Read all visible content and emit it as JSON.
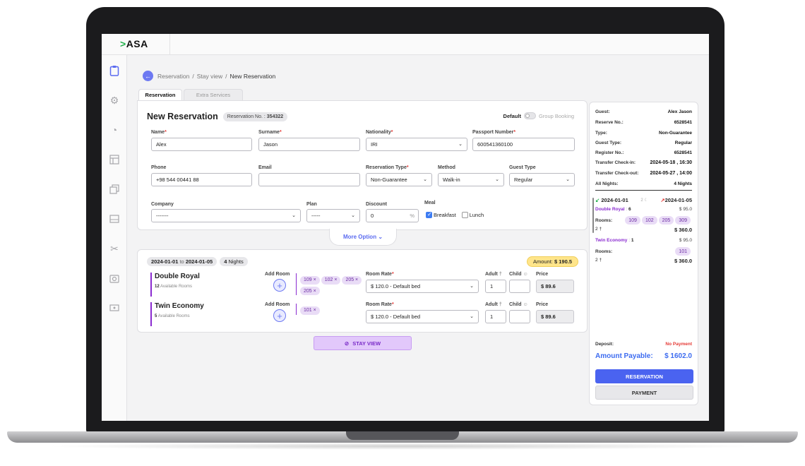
{
  "app": {
    "logo_prefix": ">",
    "logo_text": "ASA"
  },
  "sidebar": {
    "icons": [
      "clipboard-icon",
      "gear-icon",
      "pie-chart-icon",
      "layout-icon",
      "copy-icon",
      "wallet-icon",
      "magic-icon",
      "camera-icon",
      "money-icon"
    ]
  },
  "breadcrumb": {
    "items": [
      "Reservation",
      "Stay view",
      "New Reservation"
    ],
    "separator": "/"
  },
  "tabs": [
    "Reservation",
    "Extra Services"
  ],
  "form": {
    "title": "New Reservation",
    "reservation_no_label": "Reservation No. :",
    "reservation_no": "354322",
    "default_label": "Default",
    "group_label": "Group Booking",
    "fields": {
      "name": {
        "label": "Name",
        "value": "Alex"
      },
      "surname": {
        "label": "Surname",
        "value": "Jason"
      },
      "nationality": {
        "label": "Nationality",
        "value": "IRI"
      },
      "passport": {
        "label": "Passport Number",
        "value": "600541360100"
      },
      "phone": {
        "label": "Phone",
        "value": "+98 544 00441 88"
      },
      "email": {
        "label": "Email",
        "value": ""
      },
      "reservation_type": {
        "label": "Reservation Type",
        "value": "Non-Guarantee"
      },
      "method": {
        "label": "Method",
        "value": "Walk-in"
      },
      "guest_type": {
        "label": "Guest Type",
        "value": "Regular"
      },
      "company": {
        "label": "Company",
        "value": "-------"
      },
      "plan": {
        "label": "Plan",
        "value": "-----"
      },
      "discount": {
        "label": "Discount",
        "value": "0",
        "unit": "%"
      },
      "meal": {
        "label": "Meal",
        "breakfast": "Breakfast",
        "lunch": "Lunch"
      }
    },
    "more_option": "More Option"
  },
  "stay": {
    "from": "2024-01-01",
    "to_word": "to",
    "to": "2024-01-05",
    "nights_count": "4",
    "nights_word": "Nights",
    "amount_label": "Amount:",
    "amount": "$ 190.5",
    "rooms": [
      {
        "name": "Double Royal",
        "available_count": "12",
        "available_text": "Available Rooms",
        "add_room": "Add Room",
        "pills": [
          "109 ×",
          "102 ×",
          "205 ×",
          "205 ×"
        ],
        "rate_label": "Room Rate",
        "rate": "$ 120.0 - Default bed",
        "adult_label": "Adult",
        "adult": "1",
        "child_label": "Child",
        "child": "",
        "price_label": "Price",
        "price": "$ 89.6"
      },
      {
        "name": "Twin Economy",
        "available_count": "5",
        "available_text": "Available Rooms",
        "add_room": "Add Room",
        "pills": [
          "101 ×"
        ],
        "rate_label": "Room Rate",
        "rate": "$ 120.0 - Default bed",
        "adult_label": "Adult",
        "adult": "1",
        "child_label": "Child",
        "child": "",
        "price_label": "Price",
        "price": "$ 89.6"
      }
    ],
    "stay_view_button": "STAY VIEW"
  },
  "summary": {
    "rows": [
      {
        "k": "Guest:",
        "v": "Alex Jason"
      },
      {
        "k": "Reserve No.:",
        "v": "6528541"
      },
      {
        "k": "Type:",
        "v": "Non-Guarantee"
      },
      {
        "k": "Guest Type:",
        "v": "Regular"
      },
      {
        "k": "Register No.:",
        "v": "6528541"
      },
      {
        "k": "Transfer Check-in:",
        "v": "2024-05-18 , 16:30"
      },
      {
        "k": "Transfer Check-out:",
        "v": "2024-05-27 , 14:00"
      },
      {
        "k": "All Nights:",
        "v": "4 Nights"
      }
    ],
    "check_in": "2024-01-01",
    "nights": "2",
    "check_out": "2024-01-05",
    "groups": [
      {
        "name": "Double Royal",
        "count": "6",
        "price": "$ 95.0",
        "rooms_label": "Rooms:",
        "rooms": [
          "109",
          "102",
          "205",
          "309"
        ],
        "persons": "2",
        "total": "$ 360.0"
      },
      {
        "name": "Twin Economy",
        "count": "1",
        "price": "$ 95.0",
        "rooms_label": "Rooms:",
        "rooms": [
          "101"
        ],
        "persons": "2",
        "total": "$ 360.0"
      }
    ],
    "deposit_label": "Deposit:",
    "deposit_value": "No Payment",
    "payable_label": "Amount Payable:",
    "payable_value": "$ 1602.0",
    "reservation_button": "RESERVATION",
    "payment_button": "PAYMENT"
  },
  "colors": {
    "accent": "#5b6bf0",
    "purple": "#8a2bd0",
    "danger": "#e53935",
    "amount_bg": "#ffe58a",
    "green": "#22b14c"
  }
}
